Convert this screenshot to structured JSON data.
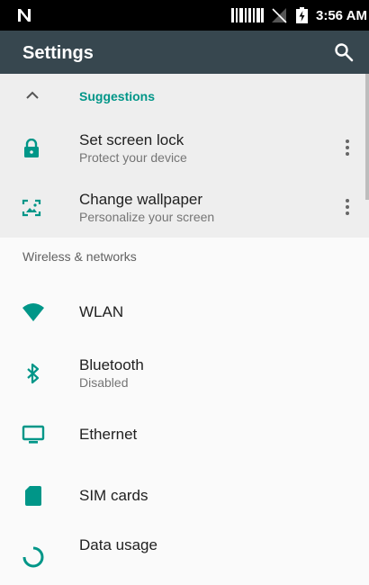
{
  "status_bar": {
    "time": "3:56 AM"
  },
  "app_bar": {
    "title": "Settings"
  },
  "suggestions": {
    "header": "Suggestions",
    "items": [
      {
        "title": "Set screen lock",
        "subtitle": "Protect your device",
        "icon": "lock-icon"
      },
      {
        "title": "Change wallpaper",
        "subtitle": "Personalize your screen",
        "icon": "wallpaper-icon"
      }
    ]
  },
  "sections": {
    "wireless_header": "Wireless & networks"
  },
  "settings": [
    {
      "title": "WLAN",
      "icon": "wifi-icon"
    },
    {
      "title": "Bluetooth",
      "subtitle": "Disabled",
      "icon": "bluetooth-icon"
    },
    {
      "title": "Ethernet",
      "icon": "ethernet-icon"
    },
    {
      "title": "SIM cards",
      "icon": "sim-card-icon"
    },
    {
      "title": "Data usage",
      "icon": "data-usage-icon"
    }
  ],
  "colors": {
    "accent": "#009688",
    "app_bar": "#37474f",
    "status_bar": "#000000",
    "suggestions_bg": "#eeeeee",
    "background": "#fafafa"
  }
}
